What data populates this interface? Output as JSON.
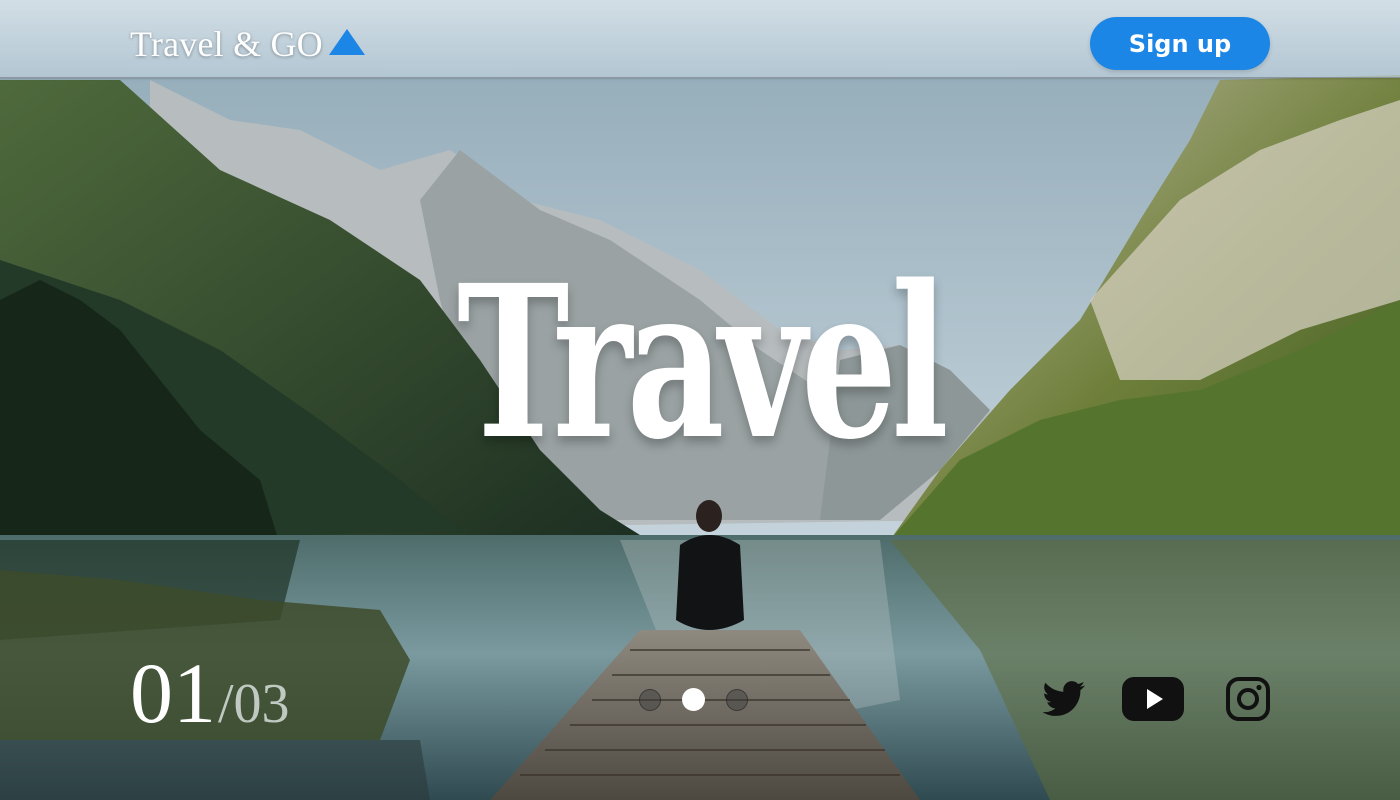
{
  "header": {
    "logo_text": "Travel & GO",
    "logo_icon": "triangle-icon",
    "signup_label": "Sign up",
    "accent_color": "#1b86e6"
  },
  "hero": {
    "title": "Travel"
  },
  "slider": {
    "current": "01",
    "total": "/03",
    "active_index": 1,
    "dot_count": 3
  },
  "social": [
    {
      "icon": "twitter-icon"
    },
    {
      "icon": "youtube-icon"
    },
    {
      "icon": "instagram-icon"
    }
  ]
}
